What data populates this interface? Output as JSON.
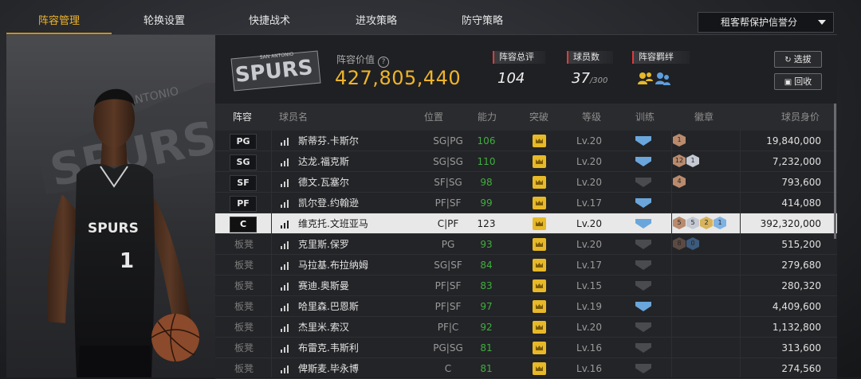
{
  "tabs": [
    {
      "label": "阵容管理",
      "active": true
    },
    {
      "label": "轮换设置",
      "active": false
    },
    {
      "label": "快捷战术",
      "active": false
    },
    {
      "label": "进攻策略",
      "active": false
    },
    {
      "label": "防守策略",
      "active": false
    }
  ],
  "dropdown": {
    "selected": "租客帮保护信誉分"
  },
  "header": {
    "value_label": "阵容价值",
    "value": "427,805,440",
    "overall_label": "阵容总评",
    "overall": "104",
    "count_label": "球员数",
    "count": "37",
    "count_max": "/300",
    "bond_label": "阵容羁绊",
    "select_button": "选拔",
    "recycle_button": "回收"
  },
  "table": {
    "headers": [
      "阵容",
      "球员名",
      "位置",
      "能力",
      "突破",
      "等级",
      "训练",
      "徽章",
      "球员身价"
    ],
    "rows": [
      {
        "slot": "PG",
        "starter": true,
        "name": "斯蒂芬.卡斯尔",
        "position": "SG|PG",
        "ability": "106",
        "level": "Lv.20",
        "trained": true,
        "badges": [
          {
            "type": "b",
            "num": "1"
          }
        ],
        "value": "19,840,000",
        "selected": false
      },
      {
        "slot": "SG",
        "starter": true,
        "name": "达龙.福克斯",
        "position": "SG|SG",
        "ability": "110",
        "level": "Lv.20",
        "trained": true,
        "badges": [
          {
            "type": "b",
            "num": "12"
          },
          {
            "type": "s",
            "num": "1"
          }
        ],
        "value": "7,232,000",
        "selected": false
      },
      {
        "slot": "SF",
        "starter": true,
        "name": "德文.瓦塞尔",
        "position": "SF|SG",
        "ability": "98",
        "level": "Lv.20",
        "trained": false,
        "badges": [
          {
            "type": "b",
            "num": "4"
          }
        ],
        "value": "793,600",
        "selected": false
      },
      {
        "slot": "PF",
        "starter": true,
        "name": "凯尔登.约翰逊",
        "position": "PF|SF",
        "ability": "99",
        "level": "Lv.17",
        "trained": true,
        "badges": [],
        "value": "414,080",
        "selected": false
      },
      {
        "slot": "C",
        "starter": true,
        "name": "维克托.文班亚马",
        "position": "C|PF",
        "ability": "123",
        "level": "Lv.20",
        "trained": true,
        "badges": [
          {
            "type": "b",
            "num": "5"
          },
          {
            "type": "s",
            "num": "5"
          },
          {
            "type": "g",
            "num": "2"
          },
          {
            "type": "p",
            "num": "1"
          }
        ],
        "value": "392,320,000",
        "selected": true
      },
      {
        "slot": "板凳",
        "starter": false,
        "name": "克里斯.保罗",
        "position": "PG",
        "ability": "93",
        "level": "Lv.20",
        "trained": false,
        "badges": [
          {
            "type": "bd-dim",
            "num": "8"
          },
          {
            "type": "sd-dim",
            "num": "0"
          }
        ],
        "value": "515,200",
        "selected": false
      },
      {
        "slot": "板凳",
        "starter": false,
        "name": "马拉基.布拉纳姆",
        "position": "SG|SF",
        "ability": "84",
        "level": "Lv.17",
        "trained": false,
        "badges": [],
        "value": "279,680",
        "selected": false
      },
      {
        "slot": "板凳",
        "starter": false,
        "name": "赛迪.奥斯曼",
        "position": "PF|SF",
        "ability": "83",
        "level": "Lv.15",
        "trained": false,
        "badges": [],
        "value": "280,320",
        "selected": false
      },
      {
        "slot": "板凳",
        "starter": false,
        "name": "哈里森.巴恩斯",
        "position": "PF|SF",
        "ability": "97",
        "level": "Lv.19",
        "trained": true,
        "badges": [],
        "value": "4,409,600",
        "selected": false
      },
      {
        "slot": "板凳",
        "starter": false,
        "name": "杰里米.索汉",
        "position": "PF|C",
        "ability": "92",
        "level": "Lv.20",
        "trained": false,
        "badges": [],
        "value": "1,132,800",
        "selected": false
      },
      {
        "slot": "板凳",
        "starter": false,
        "name": "布雷克.韦斯利",
        "position": "PG|SG",
        "ability": "81",
        "level": "Lv.16",
        "trained": false,
        "badges": [],
        "value": "313,600",
        "selected": false
      },
      {
        "slot": "板凳",
        "starter": false,
        "name": "俾斯麦.毕永博",
        "position": "C",
        "ability": "81",
        "level": "Lv.16",
        "trained": false,
        "badges": [],
        "value": "274,560",
        "selected": false
      }
    ]
  },
  "colors": {
    "accent": "#f0b429",
    "ability": "#3fae3f",
    "stat_marker": "#e03a3a",
    "train_on": "#6aa6dc"
  }
}
